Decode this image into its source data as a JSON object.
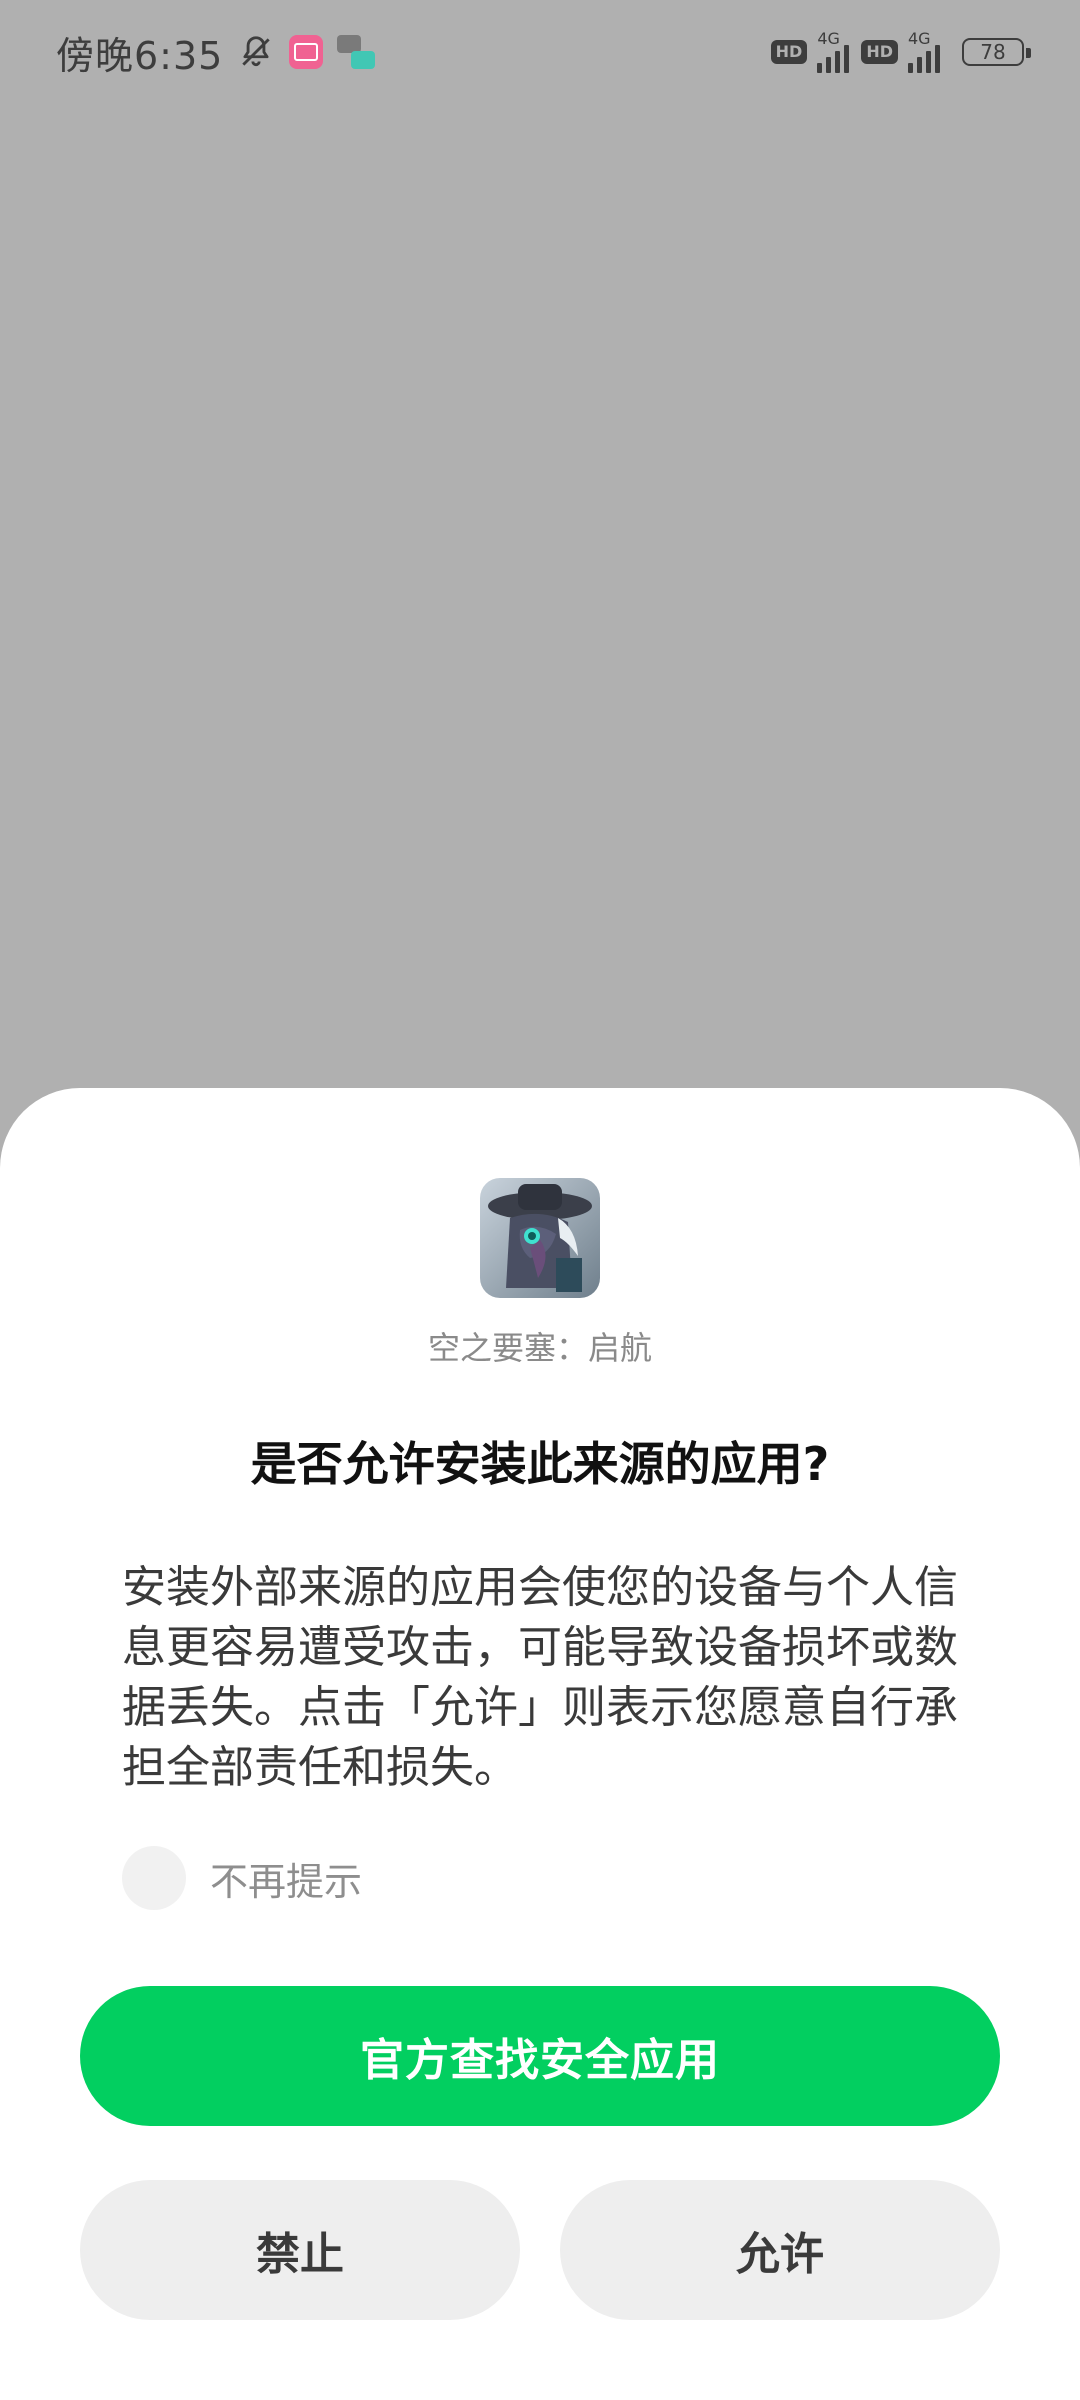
{
  "status_bar": {
    "time": "傍晚6:35",
    "icons": [
      "bell-off-icon",
      "app-notification-icon",
      "chat-notification-icon"
    ],
    "sim1": {
      "hd": "HD",
      "network": "4G",
      "signal_bars": 4
    },
    "sim2": {
      "hd": "HD",
      "network": "4G",
      "signal_bars": 4
    },
    "battery": "78"
  },
  "dialog": {
    "app_name": "空之要塞：启航",
    "title": "是否允许安装此来源的应用?",
    "message": "安装外部来源的应用会使您的设备与个人信息更容易遭受攻击，可能导致设备损坏或数据丢失。点击「允许」则表示您愿意自行承担全部责任和损失。",
    "checkbox_label": "不再提示",
    "checkbox_checked": false,
    "primary_button": "官方查找安全应用",
    "deny_button": "禁止",
    "allow_button": "允许",
    "colors": {
      "primary": "#02cf60",
      "scrim": "#b0b0b0",
      "secondary_button": "#eeeeee"
    }
  }
}
